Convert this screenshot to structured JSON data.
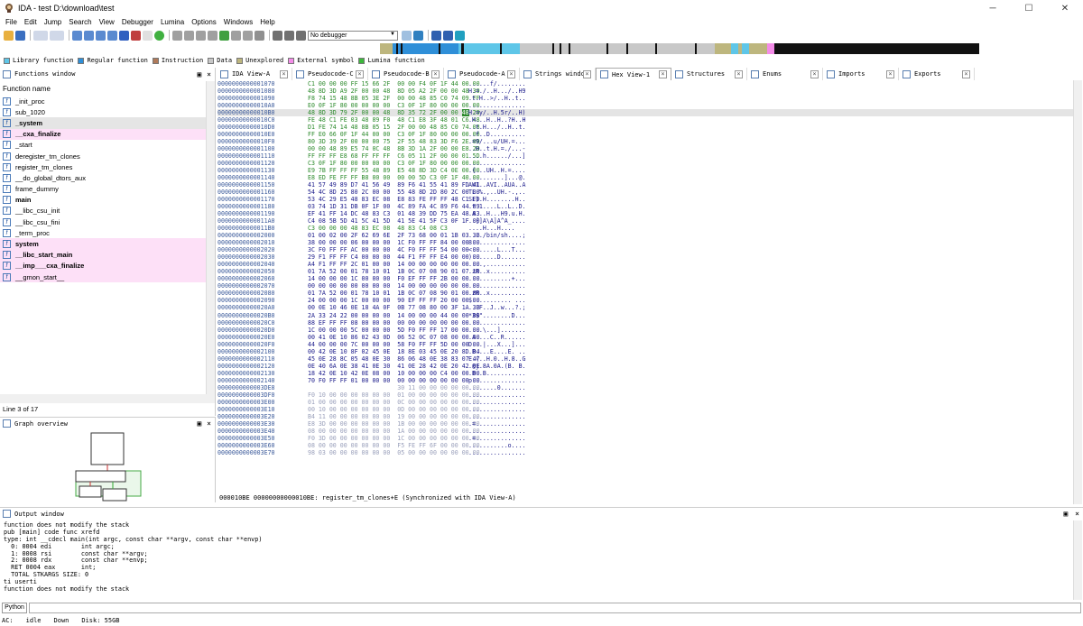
{
  "window": {
    "title": "IDA - test D:\\download\\test",
    "min": "─",
    "max": "☐",
    "close": "✕"
  },
  "menu": [
    "File",
    "Edit",
    "Jump",
    "Search",
    "View",
    "Debugger",
    "Lumina",
    "Options",
    "Windows",
    "Help"
  ],
  "toolbar": {
    "debugger_select": "No debugger"
  },
  "legend": [
    {
      "label": "Library function",
      "color": "#5ec6e8"
    },
    {
      "label": "Regular function",
      "color": "#2f8fd8"
    },
    {
      "label": "Instruction",
      "color": "#b07a5a"
    },
    {
      "label": "Data",
      "color": "#c8c8c8"
    },
    {
      "label": "Unexplored",
      "color": "#bdb67e"
    },
    {
      "label": "External symbol",
      "color": "#f48ce8"
    },
    {
      "label": "Lumina function",
      "color": "#3cb83c"
    }
  ],
  "tabs": [
    {
      "label": "IDA View-A"
    },
    {
      "label": "Pseudocode-C"
    },
    {
      "label": "Pseudocode-B"
    },
    {
      "label": "Pseudocode-A"
    },
    {
      "label": "Strings window"
    },
    {
      "label": "Hex View-1"
    },
    {
      "label": "Structures"
    },
    {
      "label": "Enums"
    },
    {
      "label": "Imports"
    },
    {
      "label": "Exports"
    }
  ],
  "functions": {
    "title": "Functions window",
    "column": "Function name",
    "items": [
      {
        "name": "_init_proc",
        "style": ""
      },
      {
        "name": "sub_1020",
        "style": ""
      },
      {
        "name": "_system",
        "style": "sel bold"
      },
      {
        "name": "__cxa_finalize",
        "style": "pink bold"
      },
      {
        "name": "_start",
        "style": ""
      },
      {
        "name": "deregister_tm_clones",
        "style": ""
      },
      {
        "name": "register_tm_clones",
        "style": ""
      },
      {
        "name": "__do_global_dtors_aux",
        "style": ""
      },
      {
        "name": "frame_dummy",
        "style": ""
      },
      {
        "name": "main",
        "style": "bold"
      },
      {
        "name": "__libc_csu_init",
        "style": ""
      },
      {
        "name": "__libc_csu_fini",
        "style": ""
      },
      {
        "name": "_term_proc",
        "style": ""
      },
      {
        "name": "system",
        "style": "pink bold"
      },
      {
        "name": "__libc_start_main",
        "style": "pink bold"
      },
      {
        "name": "__imp___cxa_finalize",
        "style": "pink bold"
      },
      {
        "name": "__gmon_start__",
        "style": "pink"
      }
    ],
    "status": "Line 3 of 17"
  },
  "graph_overview": {
    "title": "Graph overview"
  },
  "hex": {
    "rows": [
      {
        "a": "0000000000001070",
        "b": "C1 00 00 00 FF 15 66 2F  00 00 F4 0F 1F 44 00 00",
        "c": "......f/........",
        "k": ""
      },
      {
        "a": "0000000000001080",
        "b": "48 8D 3D A9 2F 00 00 48  8D 05 A2 2F 00 00 48 39",
        "c": "H.=./..H.../..H9",
        "k": ""
      },
      {
        "a": "0000000000001090",
        "b": "F8 74 15 48 8B 05 3E 2F  00 00 48 85 C0 74 09 FF",
        "c": ".t.H..>/..H..t..",
        "k": ""
      },
      {
        "a": "00000000000010A0",
        "b": "E0 0F 1F 80 00 00 00 00  C3 0F 1F 80 00 00 00 00",
        "c": "................",
        "k": ""
      },
      {
        "a": "00000000000010B0",
        "b": "48 8D 3D 79 2F 00 00 48  8D 35 72 2F 00 00 48 29",
        "c": "H.=y/..H.5r/..H)",
        "k": "cur"
      },
      {
        "a": "00000000000010C0",
        "b": "FE 48 C1 FE 03 48 89 F0  48 C1 E8 3F 48 01 C6 48",
        "c": ".H...H..H..?H..H",
        "k": ""
      },
      {
        "a": "00000000000010D0",
        "b": "D1 FE 74 14 48 8B 05 15  2F 00 00 48 85 C0 74 08",
        "c": "..t.H.../..H..t.",
        "k": ""
      },
      {
        "a": "00000000000010E0",
        "b": "FF E0 66 0F 1F 44 00 00  C3 0F 1F 80 00 00 00 00",
        "c": "..f..D..........",
        "k": ""
      },
      {
        "a": "00000000000010F0",
        "b": "80 3D 39 2F 00 00 00 75  2F 55 48 83 3D F6 2E 00",
        "c": ".=9/...u/UH.=...",
        "k": ""
      },
      {
        "a": "0000000000001100",
        "b": "00 00 48 89 E5 74 0C 48  8B 3D 1A 2F 00 00 E8 2D",
        "c": "..H..t.H.=./...-",
        "k": ""
      },
      {
        "a": "0000000000001110",
        "b": "FF FF FF E8 68 FF FF FF  C6 05 11 2F 00 00 01 5D",
        "c": "....h....../...]",
        "k": ""
      },
      {
        "a": "0000000000001120",
        "b": "C3 0F 1F 80 00 00 00 00  C3 0F 1F 80 00 00 00 00",
        "c": "................",
        "k": ""
      },
      {
        "a": "0000000000001130",
        "b": "E9 7B FF FF FF 55 48 89  E5 48 8D 3D C4 0E 00 00",
        "c": ".{...UH..H.=....",
        "k": ""
      },
      {
        "a": "0000000000001140",
        "b": "E8 ED FE FF FF B8 00 00  00 00 5D C3 0F 1F 40 00",
        "c": "..........]...@.",
        "k": ""
      },
      {
        "a": "0000000000001150",
        "b": "41 57 49 89 D7 41 56 49  89 F6 41 55 41 89 FD 41",
        "c": "AWI..AVI..AUA..A",
        "k": "data"
      },
      {
        "a": "0000000000001160",
        "b": "54 4C 8D 25 80 2C 00 00  55 48 8D 2D 80 2C 00 00",
        "c": "TL.%.,..UH.-.,..",
        "k": "data"
      },
      {
        "a": "0000000000001170",
        "b": "53 4C 29 E5 48 83 EC 08  E8 83 FE FF FF 48 C1 FD",
        "c": "SL).H........H..",
        "k": "data"
      },
      {
        "a": "0000000000001180",
        "b": "03 74 1D 31 DB 0F 1F 00  4C 89 FA 4C 89 F6 44 89",
        "c": ".t.1....L..L..D.",
        "k": "data"
      },
      {
        "a": "0000000000001190",
        "b": "EF 41 FF 14 DC 48 83 C3  01 48 39 DD 75 EA 48 83",
        "c": ".A...H...H9.u.H.",
        "k": "data"
      },
      {
        "a": "00000000000011A0",
        "b": "C4 08 5B 5D 41 5C 41 5D  41 5E 41 5F C3 0F 1F 00",
        "c": "..[]A\\A]A^A_....",
        "k": "data"
      },
      {
        "a": "00000000000011B0",
        "b": "C3 00 00 00 48 83 EC 08  48 83 C4 08 C3",
        "c": "....H...H....",
        "k": ""
      },
      {
        "a": "0000000000002000",
        "b": "01 00 02 00 2F 62 69 6E  2F 73 68 00 01 1B 03 3B",
        "c": "..../bin/sh....;",
        "k": "data"
      },
      {
        "a": "0000000000002010",
        "b": "38 00 00 00 06 00 00 00  1C F0 FF FF 84 00 00 00",
        "c": "8...............",
        "k": "data"
      },
      {
        "a": "0000000000002020",
        "b": "3C F0 FF FF AC 00 00 00  4C F0 FF FF 54 00 00 00",
        "c": "<.......L...T...",
        "k": "data"
      },
      {
        "a": "0000000000002030",
        "b": "29 F1 FF FF C4 00 00 00  44 F1 FF FF E4 00 00 00",
        "c": ").......D.......",
        "k": "data"
      },
      {
        "a": "0000000000002040",
        "b": "A4 F1 FF FF 2C 01 00 00  14 00 00 00 00 00 00 00",
        "c": "....,...........",
        "k": "data"
      },
      {
        "a": "0000000000002050",
        "b": "01 7A 52 00 01 78 10 01  1B 0C 07 08 90 01 07 10",
        "c": ".zR..x..........",
        "k": "data"
      },
      {
        "a": "0000000000002060",
        "b": "14 00 00 00 1C 00 00 00  F0 EF FF FF 2B 00 00 00",
        "c": "............+...",
        "k": "data"
      },
      {
        "a": "0000000000002070",
        "b": "00 00 00 00 00 00 00 00  14 00 00 00 00 00 00 00",
        "c": "................",
        "k": "data"
      },
      {
        "a": "0000000000002080",
        "b": "01 7A 52 00 01 78 10 01  1B 0C 07 08 90 01 00 00",
        "c": ".zR..x..........",
        "k": "data"
      },
      {
        "a": "0000000000002090",
        "b": "24 00 00 00 1C 00 00 00  90 EF FF FF 20 00 00 00",
        "c": "$........... ...",
        "k": "data"
      },
      {
        "a": "00000000000020A0",
        "b": "00 0E 10 46 0E 18 4A 0F  0B 77 08 80 00 3F 1A 3B",
        "c": "...F..J..w...?.;",
        "k": "data"
      },
      {
        "a": "00000000000020B0",
        "b": "2A 33 24 22 00 00 00 00  14 00 00 00 44 00 00 00",
        "c": "*3$\"........D...",
        "k": "data"
      },
      {
        "a": "00000000000020C0",
        "b": "88 EF FF FF 08 00 00 00  00 00 00 00 00 00 00 00",
        "c": "................",
        "k": "data"
      },
      {
        "a": "00000000000020D0",
        "b": "1C 00 00 00 5C 00 00 00  5D F0 FF FF 17 00 00 00",
        "c": "....\\...].......",
        "k": "data"
      },
      {
        "a": "00000000000020E0",
        "b": "00 41 0E 10 86 02 43 0D  06 52 0C 07 08 00 00 00",
        "c": ".A....C..R......",
        "k": "data"
      },
      {
        "a": "00000000000020F0",
        "b": "44 00 00 00 7C 00 00 00  58 F0 FF FF 5D 00 00 00",
        "c": "D...|...X...]...",
        "k": "data"
      },
      {
        "a": "0000000000002100",
        "b": "00 42 0E 10 8F 02 45 0E  18 8E 03 45 0E 20 8D 04",
        "c": ".B....E....E. ..",
        "k": "data"
      },
      {
        "a": "0000000000002110",
        "b": "45 0E 28 8C 05 48 0E 30  86 06 48 0E 38 83 07 47",
        "c": "E.(..H.0..H.8..G",
        "k": "data"
      },
      {
        "a": "0000000000002120",
        "b": "0E 40 6A 0E 38 41 0E 30  41 0E 28 42 0E 20 42 0E",
        "c": ".@j.8A.0A.(B. B.",
        "k": "data"
      },
      {
        "a": "0000000000002130",
        "b": "18 42 0E 10 42 0E 08 00  10 00 00 00 C4 00 00 00",
        "c": ".B..B...........",
        "k": "data"
      },
      {
        "a": "0000000000002140",
        "b": "70 F0 FF FF 01 00 00 00  00 00 00 00 00 00 00 00",
        "c": "p...............",
        "k": "data"
      },
      {
        "a": "0000000000003DE8",
        "b": "                         30 11 00 00 00 00 00 00",
        "c": "........0.......",
        "k": "dim"
      },
      {
        "a": "0000000000003DF0",
        "b": "F0 10 00 00 00 00 00 00  01 00 00 00 00 00 00 00",
        "c": "................",
        "k": "dim"
      },
      {
        "a": "0000000000003E00",
        "b": "01 00 00 00 00 00 00 00  0C 00 00 00 00 00 00 00",
        "c": "................",
        "k": "dim"
      },
      {
        "a": "0000000000003E10",
        "b": "00 10 00 00 00 00 00 00  0D 00 00 00 00 00 00 00",
        "c": "................",
        "k": "dim"
      },
      {
        "a": "0000000000003E20",
        "b": "B4 11 00 00 00 00 00 00  19 00 00 00 00 00 00 00",
        "c": "................",
        "k": "dim"
      },
      {
        "a": "0000000000003E30",
        "b": "E8 3D 00 00 00 00 00 00  1B 00 00 00 00 00 00 00",
        "c": ".=..............",
        "k": "dim"
      },
      {
        "a": "0000000000003E40",
        "b": "08 00 00 00 00 00 00 00  1A 00 00 00 00 00 00 00",
        "c": "................",
        "k": "dim"
      },
      {
        "a": "0000000000003E50",
        "b": "F0 3D 00 00 00 00 00 00  1C 00 00 00 00 00 00 00",
        "c": ".=..............",
        "k": "dim"
      },
      {
        "a": "0000000000003E60",
        "b": "08 00 00 00 00 00 00 00  F5 FE FF 6F 00 00 00 00",
        "c": "...........o....",
        "k": "dim"
      },
      {
        "a": "0000000000003E70",
        "b": "98 03 00 00 00 00 00 00  05 00 00 00 00 00 00 00",
        "c": "................",
        "k": "dim"
      }
    ],
    "status": "000010BE 00000000000010BE: register_tm_clones+E (Synchronized with IDA View-A)"
  },
  "output": {
    "title": "Output window",
    "lines": [
      "function does not modify the stack",
      "pub [main] code func xrefd",
      "type: int __cdecl main(int argc, const char **argv, const char **envp)",
      "  0: 0004 edi        int argc;",
      "  1: 0008 rsi        const char **argv;",
      "  2: 0008 rdx        const char **envp;",
      "  RET 0004 eax       int;",
      "  TOTAL STKARGS SIZE: 0",
      "ti userti",
      "function does not modify the stack"
    ]
  },
  "python": {
    "label": "Python"
  },
  "status": {
    "ac": "AC:",
    "state": "idle",
    "dir": "Down",
    "disk": "Disk: 55GB"
  }
}
